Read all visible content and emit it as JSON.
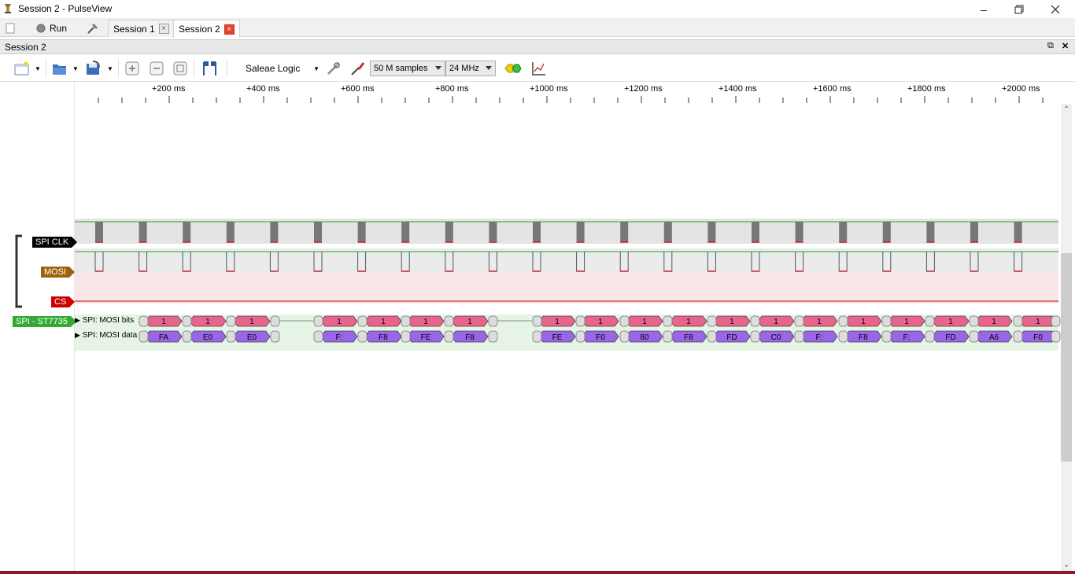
{
  "window": {
    "title": "Session 2 - PulseView"
  },
  "tabs": {
    "run_label": "Run",
    "items": [
      {
        "label": "Session 1",
        "active": false
      },
      {
        "label": "Session 2",
        "active": true
      }
    ]
  },
  "dock": {
    "title": "Session 2"
  },
  "toolbar": {
    "device": "Saleae Logic",
    "samples": "50 M samples",
    "rate": "24 MHz"
  },
  "ruler": {
    "labels": [
      "+200 ms",
      "+400 ms",
      "+600 ms",
      "+800 ms",
      "+1000 ms",
      "+1200 ms",
      "+1400 ms",
      "+1600 ms",
      "+1800 ms",
      "+2000 ms"
    ]
  },
  "channels": {
    "clk": {
      "label": "SPI CLK",
      "color": "#000000"
    },
    "mosi": {
      "label": "MOSI",
      "color": "#a0620c"
    },
    "cs": {
      "label": "CS",
      "color": "#cc0000"
    },
    "decoder": {
      "label": "SPI - ST7735",
      "color": "#33aa33",
      "bits_row": "SPI: MOSI bits",
      "data_row": "SPI: MOSI data"
    }
  },
  "annotations": {
    "bits": [
      "1",
      "1",
      "1",
      "1",
      "1",
      "1",
      "1",
      "1",
      "1",
      "1",
      "1",
      "1",
      "1",
      "1",
      "1",
      "1",
      "1",
      "1",
      "1"
    ],
    "data": [
      "FA",
      "E0",
      "E0",
      "F:",
      "F8",
      "FE",
      "F8",
      "FE",
      "F0",
      "80",
      "F8",
      "FD",
      "C0",
      "F:",
      "F8",
      "F:",
      "FD",
      "A6",
      "F0"
    ]
  },
  "colors": {
    "bits_fill": "#e8648a",
    "data_fill": "#9966e8",
    "decoder_bg": "#e6f4e6",
    "cs_bg": "#f9e6e6",
    "clk_bg": "#e4e4e4"
  }
}
